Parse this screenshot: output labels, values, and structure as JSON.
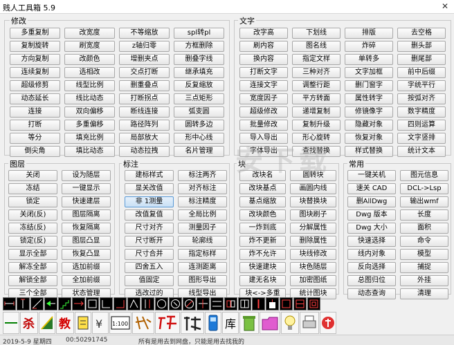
{
  "window": {
    "title": "贱人工具箱 5.9",
    "close_label": "✕"
  },
  "modify": {
    "label": "修改",
    "buttons": [
      "多重复制",
      "改宽度",
      "不等缩放",
      "spl转pl",
      "复制旋转",
      "刷宽度",
      "z轴归零",
      "方框删除",
      "方向复制",
      "改颜色",
      "增删夹点",
      "删叠字线",
      "连续复制",
      "选相改",
      "交点打断",
      "继承填充",
      "超级修剪",
      "线型比例",
      "删重叠点",
      "反复缩放",
      "动态延长",
      "线比动态",
      "打断拐点",
      "三点矩形",
      "连接",
      "双向偏移",
      "断线连接",
      "弧变圆",
      "打断",
      "多重偏移",
      "路径阵列",
      "圆转多边",
      "等分",
      "填充比例",
      "局部放大",
      "形中心线",
      "倒尖角",
      "填比动态",
      "动态拉拽",
      "名片管理"
    ]
  },
  "text": {
    "label": "文字",
    "buttons": [
      "改字高",
      "下划线",
      "排版",
      "去空格",
      "刷内容",
      "图名线",
      "炸碎",
      "删头部",
      "换内容",
      "指定文样",
      "单转多",
      "删尾部",
      "打断文字",
      "三种对齐",
      "文字加框",
      "前中后缀",
      "连接文字",
      "调整行距",
      "删门窗字",
      "字统平行",
      "宽度因子",
      "平方转面",
      "属性转字",
      "按弧对齐",
      "超级修改",
      "递增复制",
      "修镜像字",
      "数字精度",
      "批量修改",
      "复制升级",
      "隐藏对象",
      "四则运算",
      "导入导出",
      "形心旋转",
      "恢复对象",
      "文字竖排",
      "字体导出",
      "查找替换",
      "样式替换",
      "统计文本"
    ]
  },
  "layer": {
    "label": "图层",
    "buttons": [
      "关闭",
      "设为随层",
      "冻结",
      "一键显示",
      "锁定",
      "快速建层",
      "关闭(反)",
      "图层隔离",
      "冻结(反)",
      "恢复隔离",
      "锁定(反)",
      "图层凸显",
      "显示全部",
      "恢复凸显",
      "解冻全部",
      "选加前缀",
      "解锁全部",
      "全加前缀",
      "三个全部",
      "状态管理"
    ]
  },
  "dimension": {
    "label": "标注",
    "buttons": [
      "建标样式",
      "标注两齐",
      "显关改值",
      "对齐标注",
      "非 1测量",
      "标注精度",
      "改值复值",
      "全局比例",
      "尺寸对齐",
      "测量因子",
      "尺寸断开",
      "轮廓线",
      "尺寸合并",
      "指定标样",
      "四舍五入",
      "连测距离",
      "值固定",
      "图形导出",
      "选改过的",
      "线型导出"
    ],
    "selected_index": 4
  },
  "block": {
    "label": "块",
    "buttons": [
      "改块名",
      "圆转块",
      "改块基点",
      "画圆内线",
      "基点缩放",
      "块替换块",
      "改块颜色",
      "图块刷子",
      "一炸到底",
      "分解属性",
      "炸不更新",
      "删除属性",
      "炸不允许",
      "块线修改",
      "快速建块",
      "块色随层",
      "建无名块",
      "加密图纸",
      "块<->多重",
      "统计图块"
    ]
  },
  "common": {
    "label": "常用",
    "buttons": [
      "一键关机",
      "图元信息",
      "速关 CAD",
      "DCL->Lsp",
      "删AllDwg",
      "输出wmf",
      "Dwg 版本",
      "长度",
      "Dwg 大小",
      "面积",
      "快速选择",
      "命令",
      "线内对象",
      "模型",
      "反向选择",
      "捕捉",
      "总图归位",
      "外挂",
      "动态查询",
      "清理"
    ]
  },
  "toolbar_row1_icons": [
    "dim-h-icon",
    "dim-v-icon",
    "dim-slant-icon",
    "arrow-left-icon",
    "stairs-icon",
    "arrow-mix-icon",
    "dim-box-icon",
    "dim-corner-icon",
    "dim-corner2-icon",
    "dim-flip-icon",
    "dim-vbar-icon",
    "circle-mark-icon",
    "circle-char-icon",
    "circle-slash-icon",
    "dim-cross-icon",
    "dim-hbar-icon",
    "dim-double-icon",
    "dim-grid-icon",
    "dim-red-icon",
    "dim-white-block-icon",
    "rect-red-icon",
    "rect-red2-icon",
    "rect-outline-icon"
  ],
  "toolbar_row2": {
    "char_sha": "杀",
    "char_jiao": "教",
    "scale_text": "1:100",
    "char_ku": "库"
  },
  "watermark": "安下载",
  "status": {
    "left": "2019-5-9  星期四",
    "mid": "00:50291745",
    "right": "所有是用去到网盘，只能是用去找我的"
  }
}
